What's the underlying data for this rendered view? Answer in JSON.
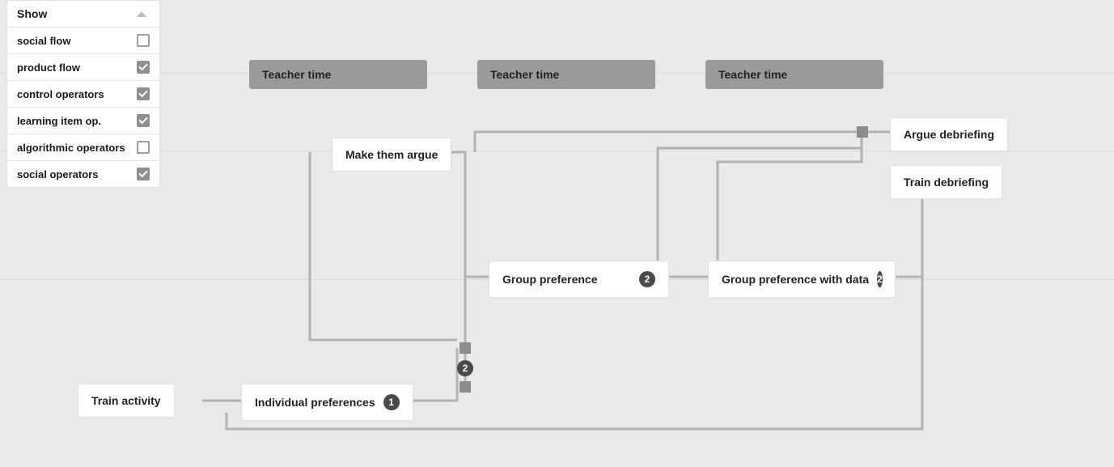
{
  "filter": {
    "header": "Show",
    "items": [
      {
        "label": "social flow",
        "checked": false
      },
      {
        "label": "product flow",
        "checked": true
      },
      {
        "label": "control operators",
        "checked": true
      },
      {
        "label": "learning item op.",
        "checked": true
      },
      {
        "label": "algorithmic operators",
        "checked": false
      },
      {
        "label": "social operators",
        "checked": true
      }
    ]
  },
  "lanes": {
    "top": "Teacher time",
    "mid": "Teacher time",
    "bot": "Teacher time"
  },
  "nodes": {
    "train_activity": {
      "label": "Train activity"
    },
    "individual_prefs": {
      "label": "Individual preferences",
      "badge": "1"
    },
    "make_argue": {
      "label": "Make them argue"
    },
    "group_pref": {
      "label": "Group preference",
      "badge": "2"
    },
    "group_pref_data": {
      "label": "Group preference with data",
      "badge": "2"
    },
    "argue_debrief": {
      "label": "Argue debriefing"
    },
    "train_debrief": {
      "label": "Train debriefing"
    }
  },
  "operators": {
    "center_badge": "2"
  }
}
